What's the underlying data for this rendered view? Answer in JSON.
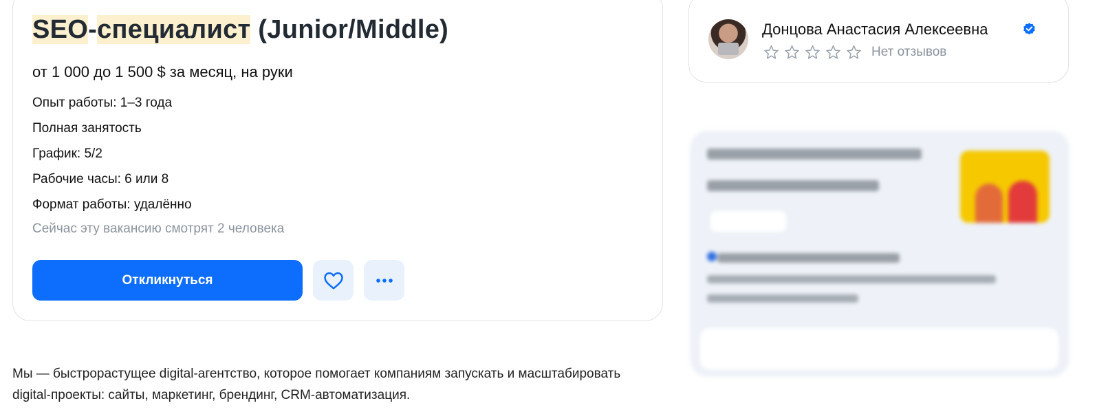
{
  "vacancy": {
    "title_part1": "SEO",
    "title_dash": "-",
    "title_part2": "специалист",
    "title_rest": " (Junior/Middle)",
    "salary": "от 1 000 до 1 500 $ за месяц, на руки",
    "facts": [
      "Опыт работы: 1–3 года",
      "Полная занятость",
      "График: 5/2",
      "Рабочие часы: 6 или 8",
      "Формат работы: удалённо"
    ],
    "viewers": "Сейчас эту вакансию смотрят 2 человека",
    "apply_label": "Откликнуться",
    "favorite_icon": "heart-icon",
    "more_icon": "more-dots-icon"
  },
  "employer": {
    "name": "Донцова Анастасия Алексеевна",
    "verified_icon": "verified-check-icon",
    "rating_stars": 5,
    "rating_filled": 0,
    "reviews": "Нет отзывов"
  },
  "description": "Мы — быстрорастущее digital-агентство, которое помогает компаниям запускать и масштабировать digital-проекты: сайты, маркетинг, брендинг, CRM-автоматизация.",
  "colors": {
    "accent": "#0d6efd",
    "highlight": "#fdf0cf",
    "muted_text": "#8a939e"
  }
}
